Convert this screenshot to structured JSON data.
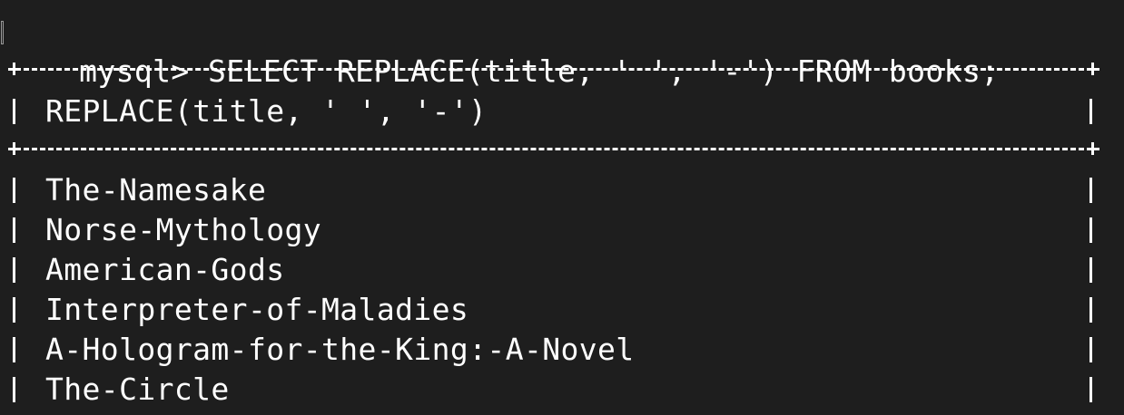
{
  "terminal": {
    "prompt": "mysql>",
    "command": "SELECT REPLACE(title, ' ', '-') FROM books;"
  },
  "result": {
    "header": "REPLACE(title, ' ', '-')",
    "rows": [
      "The-Namesake",
      "Norse-Mythology",
      "American-Gods",
      "Interpreter-of-Maladies",
      "A-Hologram-for-the-King:-A-Novel",
      "The-Circle"
    ]
  },
  "colors": {
    "background": "#1e1e1e",
    "text": "#ffffff"
  }
}
